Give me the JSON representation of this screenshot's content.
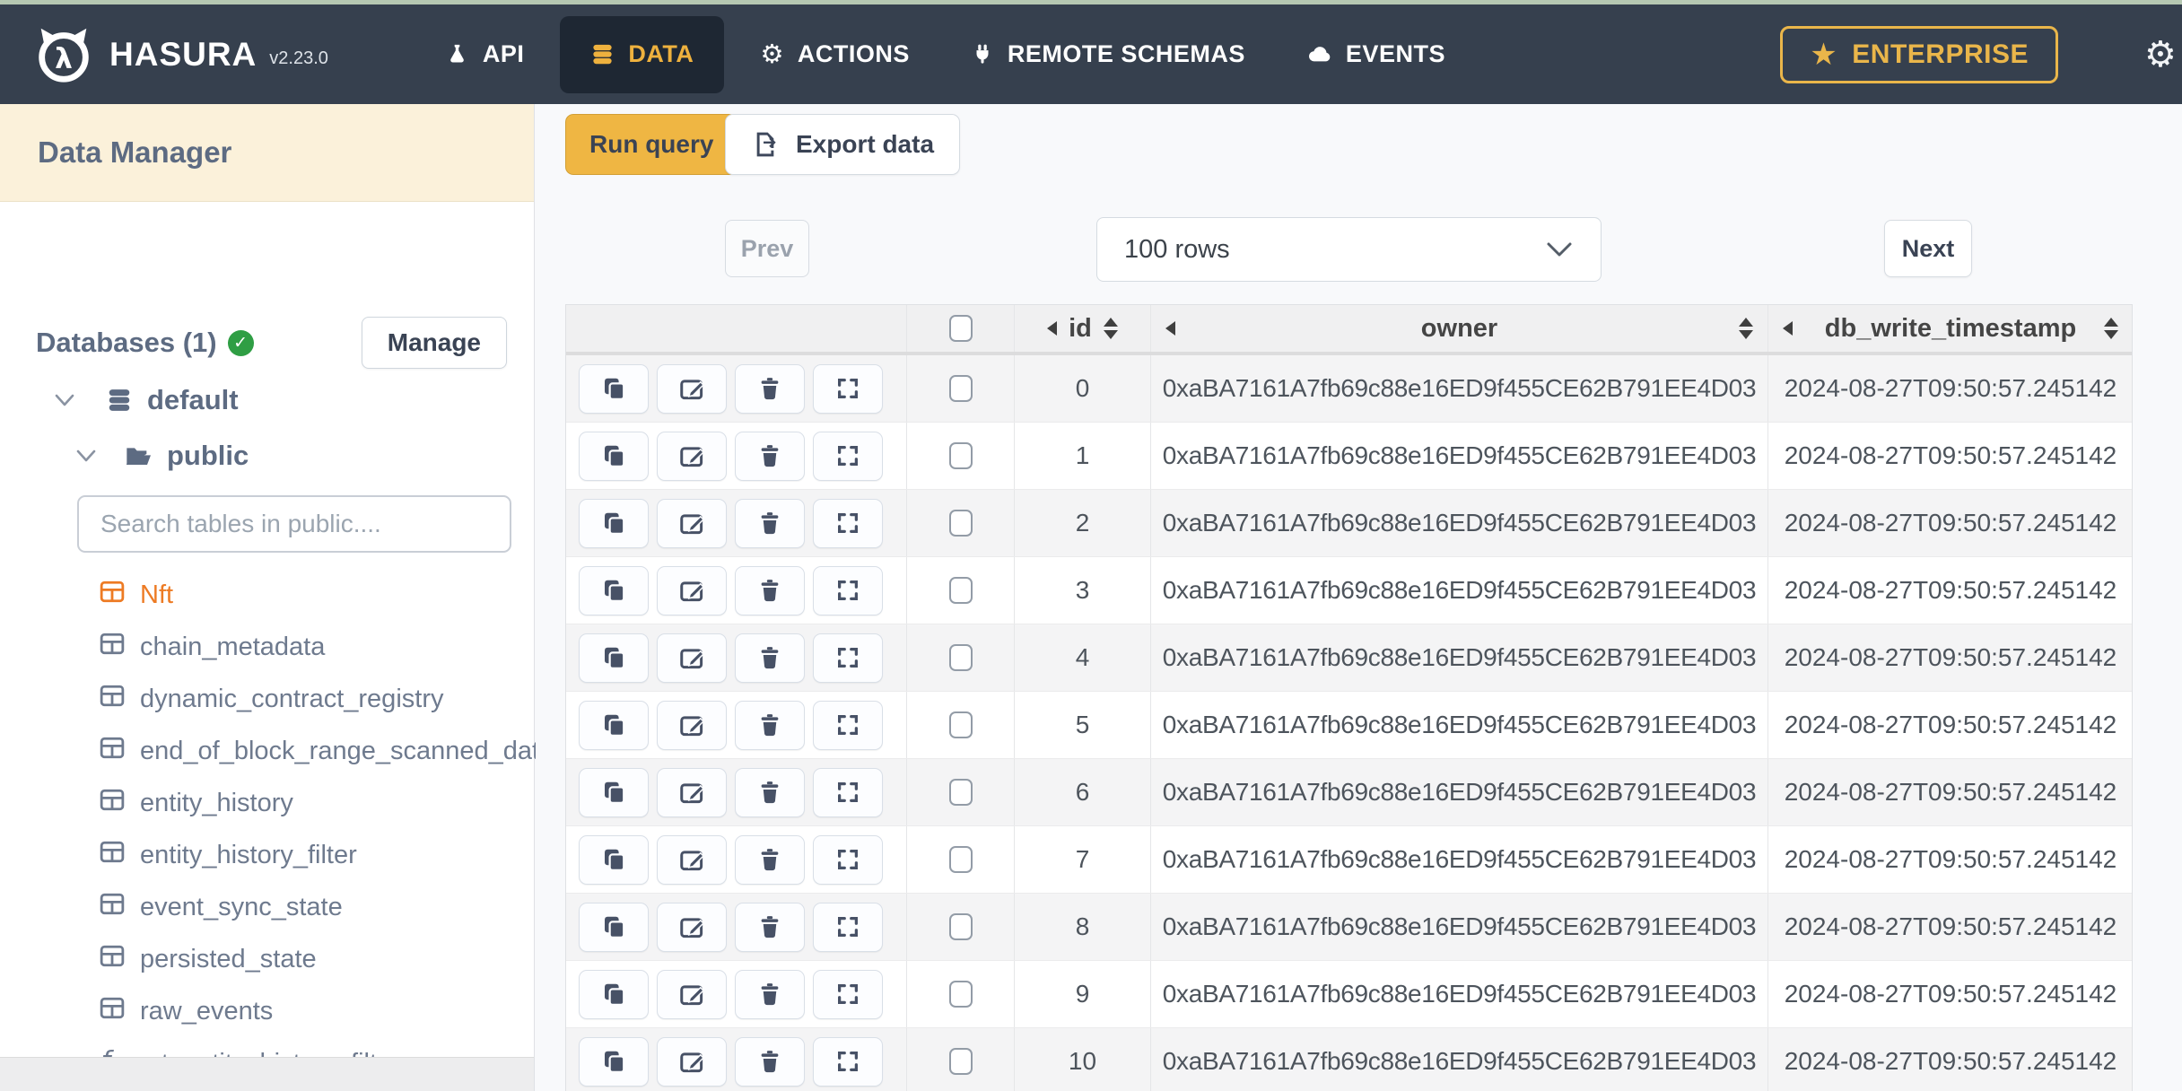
{
  "topbar": {
    "brand": "HASURA",
    "version": "v2.23.0",
    "nav": [
      {
        "label": "API",
        "icon": "flask-icon",
        "active": false
      },
      {
        "label": "DATA",
        "icon": "database-icon",
        "active": true
      },
      {
        "label": "ACTIONS",
        "icon": "gears-icon",
        "active": false
      },
      {
        "label": "REMOTE SCHEMAS",
        "icon": "plug-icon",
        "active": false
      },
      {
        "label": "EVENTS",
        "icon": "cloud-icon",
        "active": false
      }
    ],
    "enterprise_label": "ENTERPRISE"
  },
  "icons": {
    "star": "★",
    "gear": "⚙",
    "check": "✓",
    "fn": "ƒ",
    "fn_sub": "x"
  },
  "colors": {
    "nav_bg": "#36404e",
    "accent_gold": "#eab64a",
    "brand_orange": "#ed7b24",
    "status_green": "#2f9e44",
    "sidebar_header_cream": "#fbf1da"
  },
  "sidebar": {
    "title": "Data Manager",
    "databases_label": "Databases (1)",
    "manage_button": "Manage",
    "tree": {
      "database": "default",
      "schema": "public"
    },
    "search_placeholder": "Search tables in public....",
    "tables": [
      {
        "label": "Nft",
        "active": true
      },
      {
        "label": "chain_metadata",
        "active": false
      },
      {
        "label": "dynamic_contract_registry",
        "active": false
      },
      {
        "label": "end_of_block_range_scanned_data",
        "active": false
      },
      {
        "label": "entity_history",
        "active": false
      },
      {
        "label": "entity_history_filter",
        "active": false
      },
      {
        "label": "event_sync_state",
        "active": false
      },
      {
        "label": "persisted_state",
        "active": false
      },
      {
        "label": "raw_events",
        "active": false
      }
    ],
    "function_item": "get_entity_history_filter"
  },
  "toolbar": {
    "run_query": "Run query",
    "export_data": "Export data"
  },
  "pagination": {
    "prev": "Prev",
    "rows_select": "100 rows",
    "next": "Next"
  },
  "table": {
    "columns": {
      "id": "id",
      "owner": "owner",
      "timestamp": "db_write_timestamp"
    },
    "rows": [
      {
        "id": "0",
        "owner": "0xaBA7161A7fb69c88e16ED9f455CE62B791EE4D03",
        "ts": "2024-08-27T09:50:57.245142"
      },
      {
        "id": "1",
        "owner": "0xaBA7161A7fb69c88e16ED9f455CE62B791EE4D03",
        "ts": "2024-08-27T09:50:57.245142"
      },
      {
        "id": "2",
        "owner": "0xaBA7161A7fb69c88e16ED9f455CE62B791EE4D03",
        "ts": "2024-08-27T09:50:57.245142"
      },
      {
        "id": "3",
        "owner": "0xaBA7161A7fb69c88e16ED9f455CE62B791EE4D03",
        "ts": "2024-08-27T09:50:57.245142"
      },
      {
        "id": "4",
        "owner": "0xaBA7161A7fb69c88e16ED9f455CE62B791EE4D03",
        "ts": "2024-08-27T09:50:57.245142"
      },
      {
        "id": "5",
        "owner": "0xaBA7161A7fb69c88e16ED9f455CE62B791EE4D03",
        "ts": "2024-08-27T09:50:57.245142"
      },
      {
        "id": "6",
        "owner": "0xaBA7161A7fb69c88e16ED9f455CE62B791EE4D03",
        "ts": "2024-08-27T09:50:57.245142"
      },
      {
        "id": "7",
        "owner": "0xaBA7161A7fb69c88e16ED9f455CE62B791EE4D03",
        "ts": "2024-08-27T09:50:57.245142"
      },
      {
        "id": "8",
        "owner": "0xaBA7161A7fb69c88e16ED9f455CE62B791EE4D03",
        "ts": "2024-08-27T09:50:57.245142"
      },
      {
        "id": "9",
        "owner": "0xaBA7161A7fb69c88e16ED9f455CE62B791EE4D03",
        "ts": "2024-08-27T09:50:57.245142"
      },
      {
        "id": "10",
        "owner": "0xaBA7161A7fb69c88e16ED9f455CE62B791EE4D03",
        "ts": "2024-08-27T09:50:57.245142"
      }
    ]
  }
}
